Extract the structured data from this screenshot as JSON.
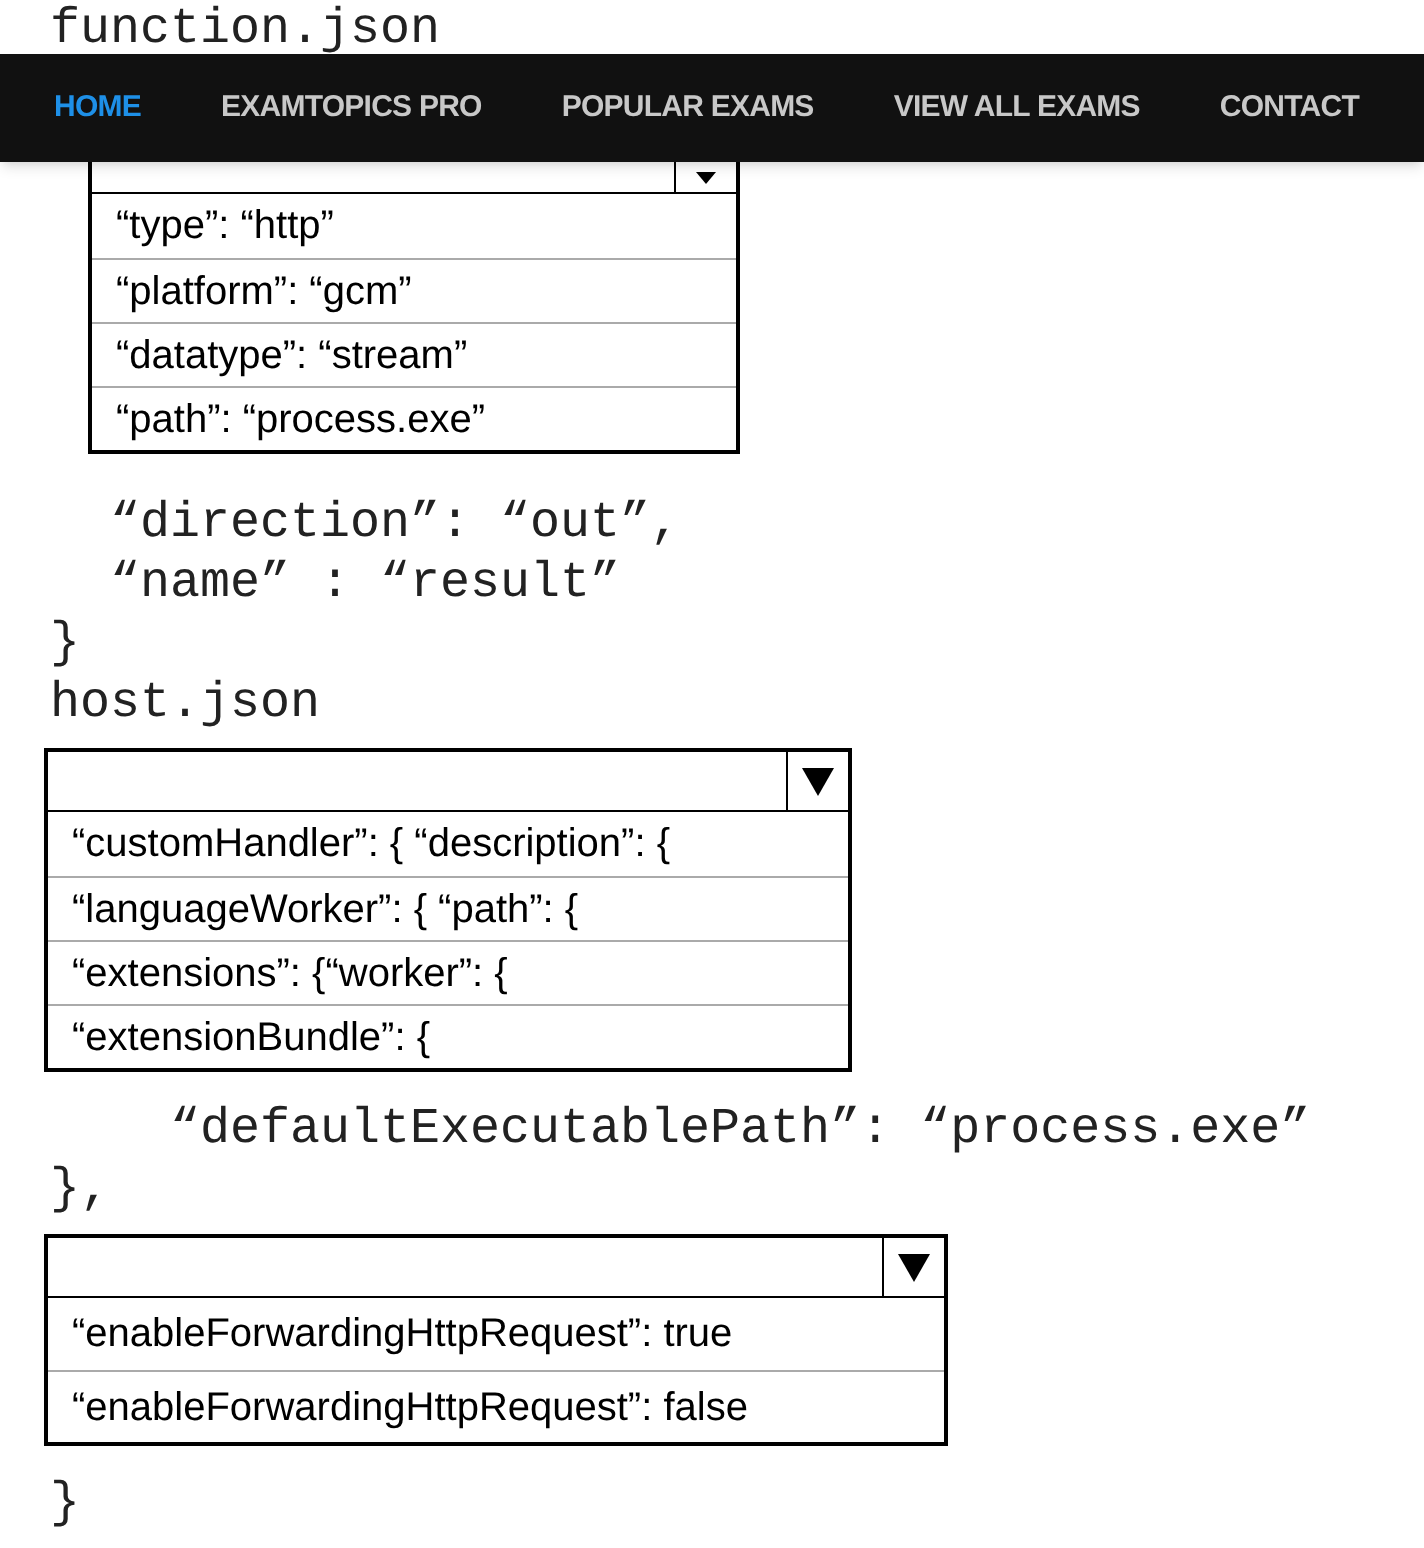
{
  "nav": {
    "items": [
      {
        "label": "HOME",
        "selected": true
      },
      {
        "label": "EXAMTOPICS PRO",
        "selected": false
      },
      {
        "label": "POPULAR EXAMS",
        "selected": false
      },
      {
        "label": "VIEW ALL EXAMS",
        "selected": false
      },
      {
        "label": "CONTACT",
        "selected": false
      }
    ]
  },
  "blocks": [
    {
      "kind": "code",
      "text": "function.json"
    },
    {
      "kind": "dropdown",
      "options": [
        {
          "label": "“type”: “http”",
          "selected": false
        },
        {
          "label": "“platform”: “gcm”",
          "selected": false
        },
        {
          "label": "“datatype”: “stream”",
          "selected": false
        },
        {
          "label": "“path”: “process.exe”",
          "selected": false
        }
      ]
    },
    {
      "kind": "code",
      "text": "  “direction”: “out”,"
    },
    {
      "kind": "code",
      "text": "  “name” : “result”"
    },
    {
      "kind": "code",
      "text": "}"
    },
    {
      "kind": "code",
      "text": "host.json"
    },
    {
      "kind": "dropdown",
      "options": [
        {
          "label": "“customHandler”: { “description”: {",
          "selected": false
        },
        {
          "label": "“languageWorker”: { “path”: {",
          "selected": false
        },
        {
          "label": "“extensions”: {“worker”: {",
          "selected": false
        },
        {
          "label": "“extensionBundle”: {",
          "selected": false
        }
      ]
    },
    {
      "kind": "code",
      "text": "    “defaultExecutablePath”: “process.exe”"
    },
    {
      "kind": "code",
      "text": "},"
    },
    {
      "kind": "dropdown",
      "options": [
        {
          "label": "“enableForwardingHttpRequest”: true",
          "selected": false
        },
        {
          "label": "“enableForwardingHttpRequest”: false",
          "selected": false
        }
      ]
    },
    {
      "kind": "code",
      "text": "}"
    }
  ]
}
